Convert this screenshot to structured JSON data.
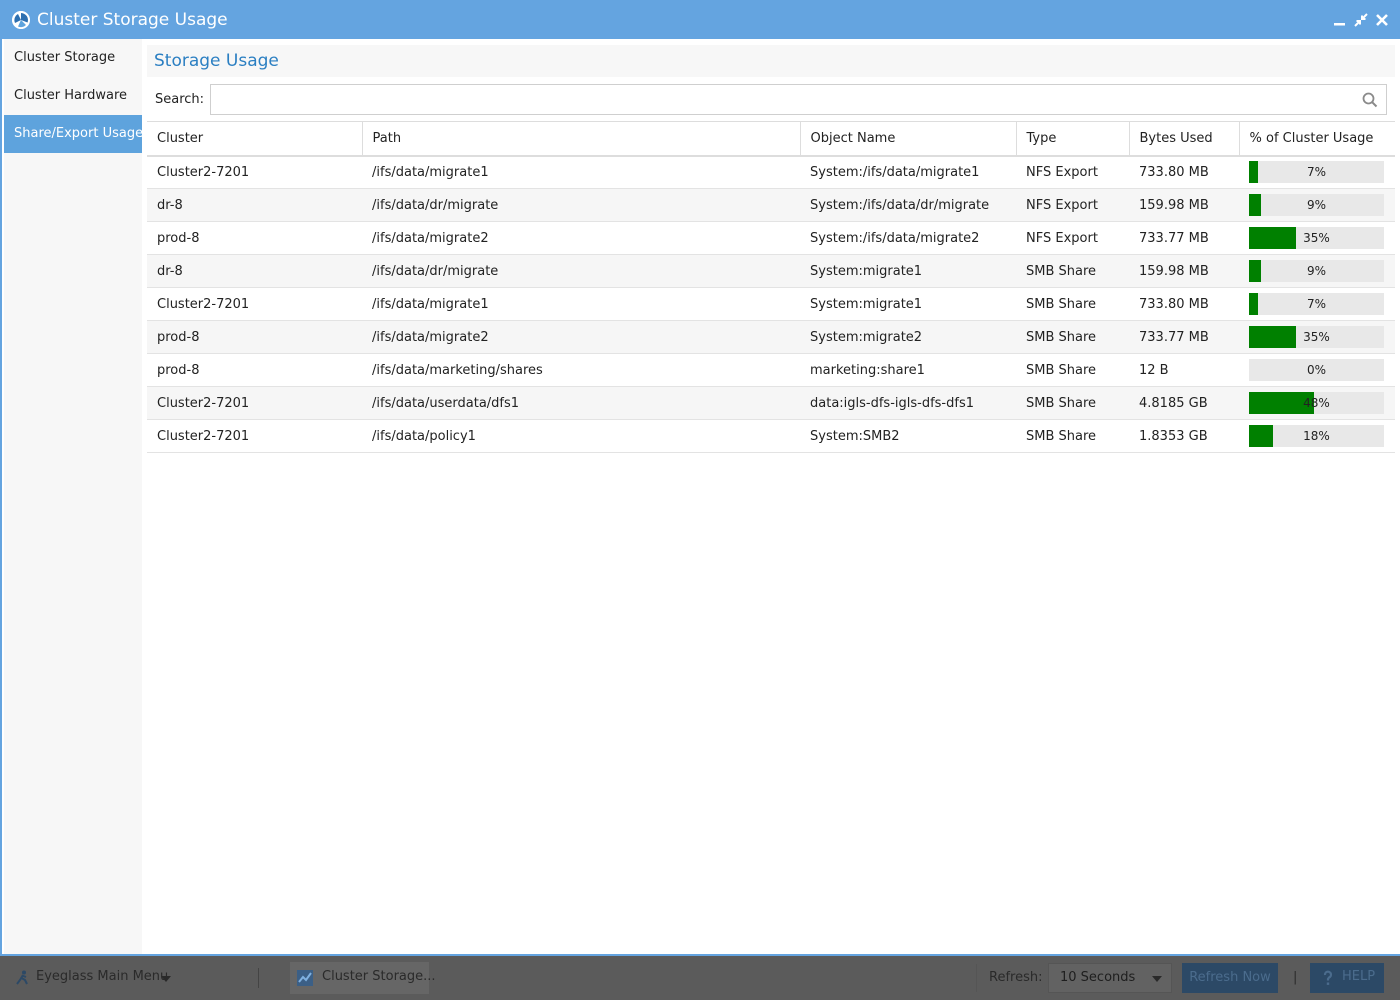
{
  "window": {
    "title": "Cluster Storage Usage",
    "accent_color": "#64a4e0"
  },
  "sidebar": {
    "items": [
      {
        "label": "Cluster Storage",
        "active": false
      },
      {
        "label": "Cluster Hardware",
        "active": false
      },
      {
        "label": "Share/Export Usage",
        "active": true
      }
    ]
  },
  "main": {
    "title": "Storage Usage",
    "search_label": "Search:",
    "search_value": "",
    "columns": [
      "Cluster",
      "Path",
      "Object Name",
      "Type",
      "Bytes Used",
      "% of Cluster Usage"
    ],
    "bar_color": "#008000",
    "rows": [
      {
        "cluster": "Cluster2-7201",
        "path": "/ifs/data/migrate1",
        "object": "System:/ifs/data/migrate1",
        "type": "NFS Export",
        "bytes": "733.80 MB",
        "pct_label": "7%",
        "pct": 7
      },
      {
        "cluster": "dr-8",
        "path": "/ifs/data/dr/migrate",
        "object": "System:/ifs/data/dr/migrate",
        "type": "NFS Export",
        "bytes": "159.98 MB",
        "pct_label": "9%",
        "pct": 9
      },
      {
        "cluster": "prod-8",
        "path": "/ifs/data/migrate2",
        "object": "System:/ifs/data/migrate2",
        "type": "NFS Export",
        "bytes": "733.77 MB",
        "pct_label": "35%",
        "pct": 35
      },
      {
        "cluster": "dr-8",
        "path": "/ifs/data/dr/migrate",
        "object": "System:migrate1",
        "type": "SMB Share",
        "bytes": "159.98 MB",
        "pct_label": "9%",
        "pct": 9
      },
      {
        "cluster": "Cluster2-7201",
        "path": "/ifs/data/migrate1",
        "object": "System:migrate1",
        "type": "SMB Share",
        "bytes": "733.80 MB",
        "pct_label": "7%",
        "pct": 7
      },
      {
        "cluster": "prod-8",
        "path": "/ifs/data/migrate2",
        "object": "System:migrate2",
        "type": "SMB Share",
        "bytes": "733.77 MB",
        "pct_label": "35%",
        "pct": 35
      },
      {
        "cluster": "prod-8",
        "path": "/ifs/data/marketing/shares",
        "object": "marketing:share1",
        "type": "SMB Share",
        "bytes": "12 B",
        "pct_label": "0%",
        "pct": 0
      },
      {
        "cluster": "Cluster2-7201",
        "path": "/ifs/data/userdata/dfs1",
        "object": "data:igls-dfs-igls-dfs-dfs1",
        "type": "SMB Share",
        "bytes": "4.8185 GB",
        "pct_label": "48%",
        "pct": 48
      },
      {
        "cluster": "Cluster2-7201",
        "path": "/ifs/data/policy1",
        "object": "System:SMB2",
        "type": "SMB Share",
        "bytes": "1.8353 GB",
        "pct_label": "18%",
        "pct": 18
      }
    ]
  },
  "taskbar": {
    "main_menu_label": "Eyeglass Main Menu",
    "task_label": "Cluster Storage...",
    "refresh_label": "Refresh:",
    "refresh_interval": "10 Seconds",
    "refresh_now_label": "Refresh Now",
    "separator": "|",
    "help_label": "HELP"
  }
}
